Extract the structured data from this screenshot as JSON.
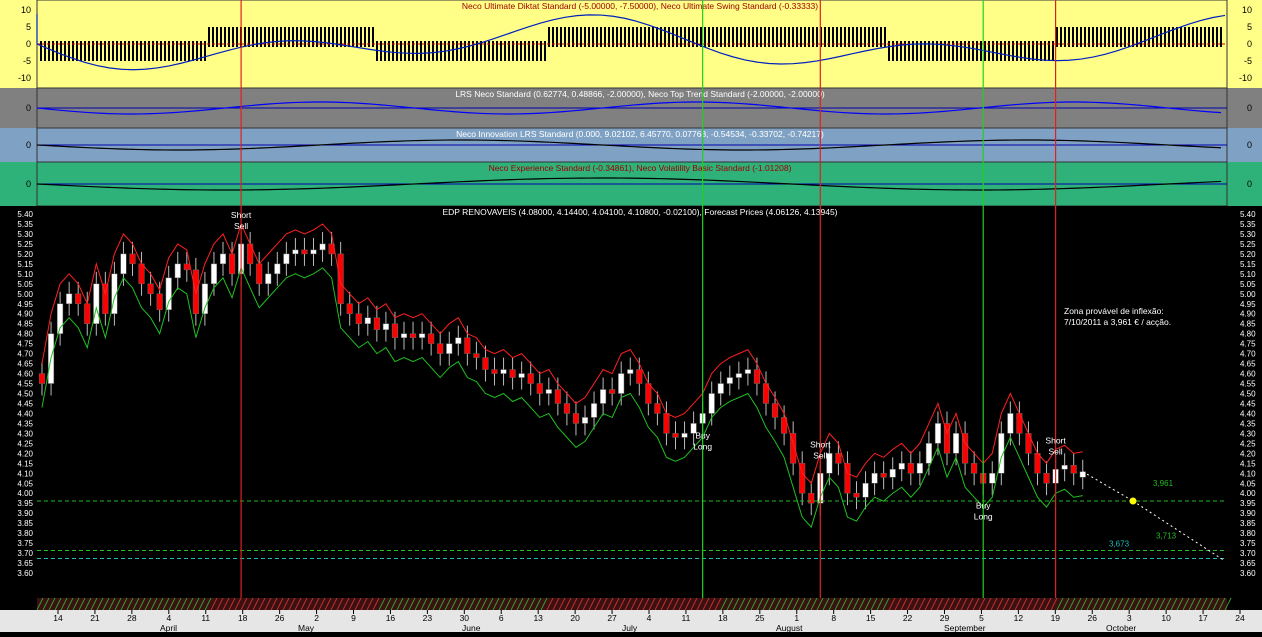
{
  "colors": {
    "panel1_bg": "#FFFF88",
    "panel2_bg": "#808080",
    "panel3_bg": "#7FA2C4",
    "panel4_bg": "#2EB27A",
    "main_bg": "#000000",
    "scale_bg": "#E6E6E6",
    "up_candle": "#FFFFFF",
    "down_candle": "#FF0000",
    "sell_line": "#E02020",
    "buy_line": "#20D020",
    "forecast_color": "#FFFF00"
  },
  "indicator_panels": [
    {
      "title": "Neco Ultimate Diktat Standard (-5.00000, -7.50000), Neco Ultimate Swing Standard (-0.33333)",
      "ticks": [
        "10",
        "5",
        "0",
        "-5",
        "-10"
      ],
      "title_color": "#A00000"
    },
    {
      "title": "LRS Neco Standard (0.62774, 0.48866, -2.00000), Neco Top Trend Standard (-2.00000, -2.00000)",
      "ticks": [
        "0"
      ],
      "title_color": "#FFFFFF"
    },
    {
      "title": "Neco Innovation LRS Standard (0.000, 9.02102, 6.45770, 0.07768, -0.54534, -0.33702, -0.74217)",
      "ticks": [
        "0"
      ],
      "title_color": "#FFFFFF"
    },
    {
      "title": "Neco Experience Standard (-0.34861), Neco Volatility Basic Standard (-1.01208)",
      "ticks": [
        "0"
      ],
      "title_color": "#A00000"
    }
  ],
  "chart_data": {
    "type": "candlestick",
    "title": "EDP RENOVAVEIS (4.08000, 4.14400, 4.04100, 4.10800, -0.02100), Forecast Prices (4.06126, 4.13945)",
    "ylim": [
      3.6,
      5.4
    ],
    "y_ticks": [
      "5.40",
      "5.35",
      "5.30",
      "5.25",
      "5.20",
      "5.15",
      "5.10",
      "5.05",
      "5.00",
      "4.95",
      "4.90",
      "4.85",
      "4.80",
      "4.75",
      "4.70",
      "4.65",
      "4.60",
      "4.55",
      "4.50",
      "4.45",
      "4.40",
      "4.35",
      "4.30",
      "4.25",
      "4.20",
      "4.15",
      "4.10",
      "4.05",
      "4.00",
      "3.95",
      "3.90",
      "3.85",
      "3.80",
      "3.75",
      "3.70",
      "3.65",
      "3.60"
    ],
    "x_ticks": [
      "14",
      "21",
      "28",
      "4",
      "11",
      "18",
      "26",
      "2",
      "9",
      "16",
      "23",
      "30",
      "6",
      "13",
      "20",
      "27",
      "4",
      "11",
      "18",
      "25",
      "1",
      "8",
      "15",
      "22",
      "29",
      "5",
      "12",
      "19",
      "26",
      "3",
      "10",
      "17",
      "24"
    ],
    "months": [
      "April",
      "May",
      "June",
      "July",
      "August",
      "September",
      "October"
    ],
    "closes": [
      4.55,
      4.8,
      4.95,
      5.0,
      4.95,
      4.85,
      5.05,
      4.9,
      5.1,
      5.2,
      5.15,
      5.05,
      5.0,
      4.92,
      5.08,
      5.15,
      5.12,
      4.9,
      5.05,
      5.15,
      5.2,
      5.1,
      5.25,
      5.15,
      5.05,
      5.1,
      5.15,
      5.2,
      5.22,
      5.2,
      5.22,
      5.25,
      5.2,
      4.95,
      4.9,
      4.85,
      4.88,
      4.82,
      4.85,
      4.78,
      4.8,
      4.78,
      4.8,
      4.75,
      4.7,
      4.75,
      4.78,
      4.7,
      4.68,
      4.62,
      4.6,
      4.62,
      4.58,
      4.6,
      4.55,
      4.5,
      4.52,
      4.45,
      4.4,
      4.35,
      4.38,
      4.45,
      4.52,
      4.5,
      4.6,
      4.62,
      4.55,
      4.45,
      4.4,
      4.3,
      4.28,
      4.3,
      4.35,
      4.4,
      4.5,
      4.55,
      4.58,
      4.6,
      4.62,
      4.55,
      4.45,
      4.38,
      4.3,
      4.15,
      4.0,
      3.95,
      4.1,
      4.2,
      4.15,
      4.0,
      3.98,
      4.05,
      4.1,
      4.08,
      4.12,
      4.15,
      4.1,
      4.15,
      4.25,
      4.35,
      4.2,
      4.3,
      4.15,
      4.1,
      4.05,
      4.1,
      4.3,
      4.4,
      4.3,
      4.2,
      4.1,
      4.05,
      4.12,
      4.14,
      4.1,
      4.108
    ],
    "opens": [
      4.6,
      4.55,
      4.8,
      4.95,
      5.0,
      4.95,
      4.85,
      5.05,
      4.9,
      5.1,
      5.2,
      5.15,
      5.05,
      5.0,
      4.92,
      5.08,
      5.15,
      5.12,
      4.9,
      5.05,
      5.15,
      5.2,
      5.1,
      5.25,
      5.15,
      5.05,
      5.1,
      5.15,
      5.2,
      5.22,
      5.2,
      5.22,
      5.25,
      5.2,
      4.95,
      4.9,
      4.85,
      4.88,
      4.82,
      4.85,
      4.78,
      4.8,
      4.78,
      4.8,
      4.75,
      4.7,
      4.75,
      4.78,
      4.7,
      4.68,
      4.62,
      4.6,
      4.62,
      4.58,
      4.6,
      4.55,
      4.5,
      4.52,
      4.45,
      4.4,
      4.35,
      4.38,
      4.45,
      4.52,
      4.5,
      4.6,
      4.62,
      4.55,
      4.45,
      4.4,
      4.3,
      4.28,
      4.3,
      4.35,
      4.4,
      4.5,
      4.55,
      4.58,
      4.6,
      4.62,
      4.55,
      4.45,
      4.38,
      4.3,
      4.15,
      4.0,
      3.95,
      4.1,
      4.2,
      4.15,
      4.0,
      3.98,
      4.05,
      4.1,
      4.08,
      4.12,
      4.15,
      4.1,
      4.15,
      4.25,
      4.35,
      4.2,
      4.3,
      4.15,
      4.1,
      4.05,
      4.1,
      4.3,
      4.4,
      4.3,
      4.2,
      4.1,
      4.05,
      4.12,
      4.14,
      4.08
    ],
    "signals": [
      {
        "label": [
          "Short",
          "Sell"
        ],
        "type": "sell",
        "bar_index": 22
      },
      {
        "label": [
          "Buy",
          "Long"
        ],
        "type": "buy",
        "bar_index": 73
      },
      {
        "label": [
          "Short",
          "Sell"
        ],
        "type": "sell",
        "bar_index": 86
      },
      {
        "label": [
          "Buy",
          "Long"
        ],
        "type": "buy",
        "bar_index": 104
      },
      {
        "label": [
          "Short",
          "Sell"
        ],
        "type": "sell",
        "bar_index": 112
      }
    ],
    "forecast": {
      "from": 4.108,
      "point": 3.961,
      "to": 3.66
    },
    "levels": [
      {
        "value": 3.961,
        "label": "3,961",
        "color": "#22BB22"
      },
      {
        "value": 3.713,
        "label": "3,713",
        "color": "#22BB22"
      },
      {
        "value": 3.673,
        "label": "3,673",
        "color": "#22BBBB"
      }
    ],
    "annotation": [
      "Zona provável de inflexão:",
      "7/10/2011 a 3,961 € / acção."
    ]
  }
}
